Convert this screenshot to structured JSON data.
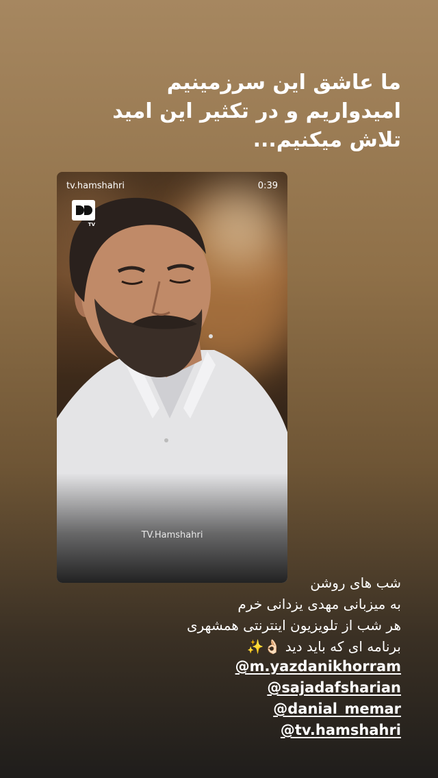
{
  "story": {
    "headline_lines": [
      "ما عاشق این سرزمینیم",
      "امیدواریم و در تکثیر این امید",
      "تلاش میکنیم..."
    ],
    "video": {
      "source": "tv.hamshahri",
      "time": "0:39",
      "logo_tag": "TV",
      "watermark": "TV.Hamshahri"
    },
    "caption_lines": [
      "شب های روشن",
      "به میزبانی مهدی یزدانی خرم",
      "هر شب از تلویزیون اینترنتی همشهری",
      "برنامه ای که باید دید 👌🏻✨"
    ],
    "mentions": [
      "@m.yazdanikhorram",
      "@sajadafsharian",
      "@danial_memar",
      "@tv.hamshahri"
    ]
  },
  "colors": {
    "bg_top": "#a68760",
    "bg_bottom": "#1f1d1b",
    "text": "#ffffff"
  }
}
